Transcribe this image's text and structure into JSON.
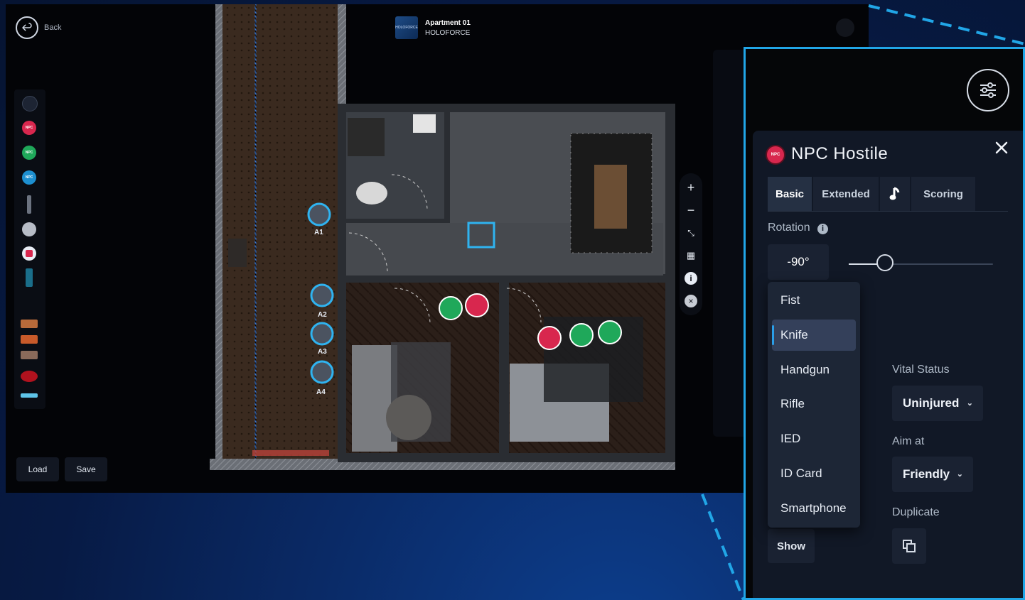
{
  "header": {
    "back_label": "Back",
    "project_title": "Apartment 01",
    "project_subtitle": "HOLOFORCE",
    "project_logo_text": "HOLOFORCE"
  },
  "actors": [
    "A1",
    "A2",
    "A3",
    "A4"
  ],
  "footer": {
    "load_label": "Load",
    "save_label": "Save"
  },
  "map_tools": [
    "zoom-in-icon",
    "zoom-out-icon",
    "fit-screen-icon",
    "layout-icon",
    "info-icon",
    "close-circle-icon"
  ],
  "palette_icons": [
    "grid-icon",
    "npc-hostile-icon",
    "npc-friendly-icon",
    "npc-neutral-icon",
    "weapon-icon",
    "sound-icon",
    "alert-icon",
    "phone-icon",
    "object-icon",
    "object-icon",
    "object-icon",
    "blood-icon",
    "drone-icon"
  ],
  "panel": {
    "title": "NPC Hostile",
    "npc_badge": "NPC",
    "tabs": [
      "Basic",
      "Extended",
      "music-note-icon",
      "Scoring"
    ],
    "active_tab": "Basic",
    "rotation_label": "Rotation",
    "rotation_value": "-90°",
    "rotation_slider_level": 0.25,
    "weapon_options": [
      "Fist",
      "Knife",
      "Handgun",
      "Rifle",
      "IED",
      "ID Card",
      "Smartphone"
    ],
    "weapon_selected": "Knife",
    "vital_status_label": "Vital Status",
    "vital_status_value": "Uninjured",
    "aim_at_label": "Aim at",
    "aim_at_value": "Friendly",
    "duplicate_label": "Duplicate",
    "show_label": "Show"
  },
  "colors": {
    "accent_blue": "#21a6e7",
    "npc_hostile": "#d8274e",
    "npc_friendly": "#1fa85a",
    "npc_neutral": "#1d8fd0",
    "background_deep": "#061431"
  }
}
